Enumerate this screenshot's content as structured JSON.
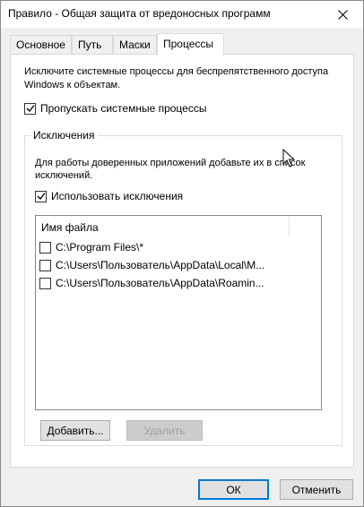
{
  "window": {
    "title": "Правило - Общая защита от вредоносных программ"
  },
  "tabs": [
    {
      "label": "Основное"
    },
    {
      "label": "Путь"
    },
    {
      "label": "Маски"
    },
    {
      "label": "Процессы",
      "active": true
    }
  ],
  "processes_tab": {
    "description": "Исключите системные процессы для беспрепятственного доступа Windows к объектам.",
    "skip_system": {
      "label": "Пропускать системные процессы",
      "checked": true
    },
    "exclusions_group": {
      "legend": "Исключения",
      "description": "Для работы доверенных приложений добавьте их в список исключений.",
      "use_exclusions": {
        "label": "Использовать исключения",
        "checked": true
      },
      "list": {
        "column_header": "Имя файла",
        "items": [
          {
            "path": "C:\\Program Files\\*",
            "checked": false
          },
          {
            "path": "C:\\Users\\Пользователь\\AppData\\Local\\M...",
            "checked": false
          },
          {
            "path": "C:\\Users\\Пользователь\\AppData\\Roamin...",
            "checked": false
          }
        ]
      },
      "add_button": "Добавить...",
      "remove_button": "Удалить"
    }
  },
  "footer": {
    "ok_button": "ОК",
    "cancel_button": "Отменить"
  },
  "colors": {
    "accent": "#0078d7",
    "window_bg": "#f0f0f0",
    "panel_bg": "#ffffff"
  }
}
